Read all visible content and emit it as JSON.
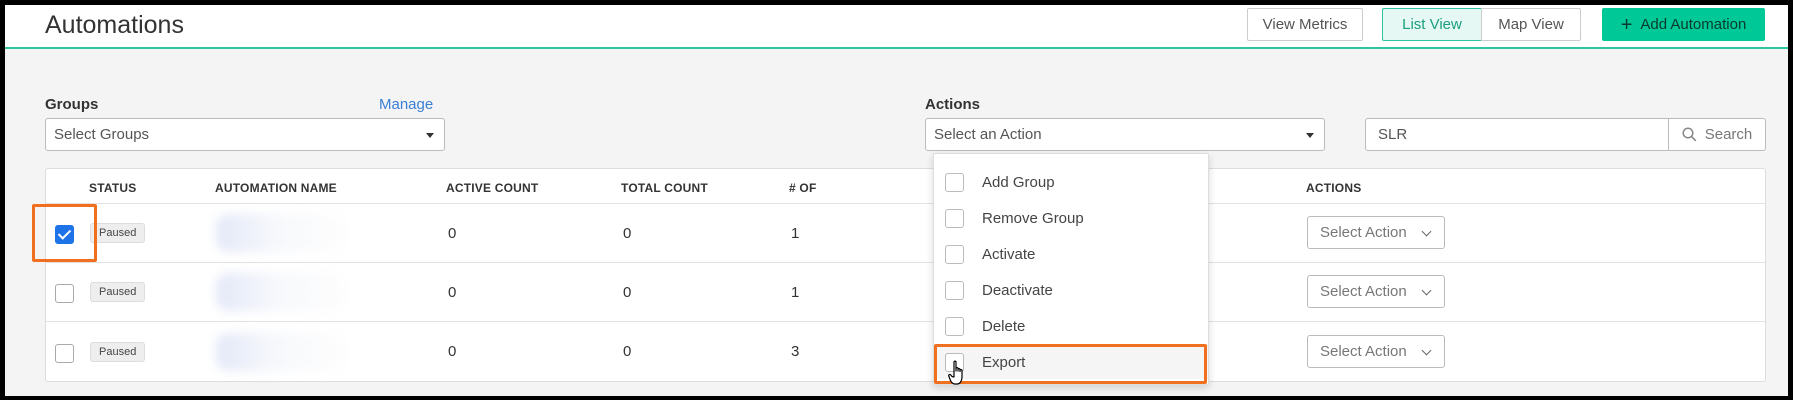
{
  "header": {
    "title": "Automations",
    "view_metrics": "View Metrics",
    "list_view": "List View",
    "map_view": "Map View",
    "add_automation": "Add Automation"
  },
  "filters": {
    "groups_label": "Groups",
    "manage_link": "Manage",
    "groups_placeholder": "Select Groups",
    "actions_label": "Actions",
    "actions_placeholder": "Select an Action",
    "search_value": "SLR",
    "search_button": "Search"
  },
  "table": {
    "columns": [
      "STATUS",
      "AUTOMATION NAME",
      "ACTIVE COUNT",
      "TOTAL COUNT",
      "# OF",
      "ACTIONS"
    ],
    "rows": [
      {
        "checked": true,
        "status": "Paused",
        "active": "0",
        "total": "0",
        "num": "1",
        "action": "Select Action"
      },
      {
        "checked": false,
        "status": "Paused",
        "active": "0",
        "total": "0",
        "num": "1",
        "action": "Select Action"
      },
      {
        "checked": false,
        "status": "Paused",
        "active": "0",
        "total": "0",
        "num": "3",
        "action": "Select Action"
      }
    ]
  },
  "action_menu": {
    "items": [
      "Add Group",
      "Remove Group",
      "Activate",
      "Deactivate",
      "Delete",
      "Export"
    ]
  },
  "colors": {
    "accent": "#00c897",
    "highlight": "#f07020",
    "checkbox": "#1e73e8"
  }
}
